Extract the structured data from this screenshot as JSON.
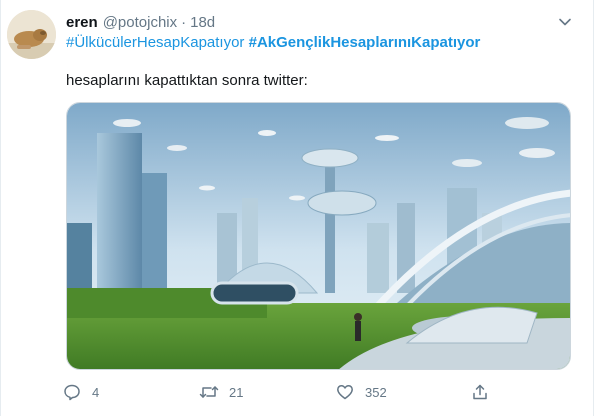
{
  "tweet": {
    "display_name": "eren",
    "handle": "@potojchix",
    "separator": "·",
    "time": "18d",
    "hashtags": [
      "#ÜlkücülerHesapKapatıyor",
      "#AkGençlikHesaplarınıKapatıyor"
    ],
    "text": "hesaplarını kapattıktan sonra twitter:",
    "media_alt": "futuristic city"
  },
  "actions": {
    "reply_count": "4",
    "retweet_count": "21",
    "like_count": "352"
  },
  "icons": {
    "more": "chevron-down-icon",
    "reply": "reply-icon",
    "retweet": "retweet-icon",
    "like": "heart-icon",
    "share": "share-icon"
  },
  "colors": {
    "link": "#1b95e0",
    "secondary": "#657786",
    "text": "#14171a"
  }
}
